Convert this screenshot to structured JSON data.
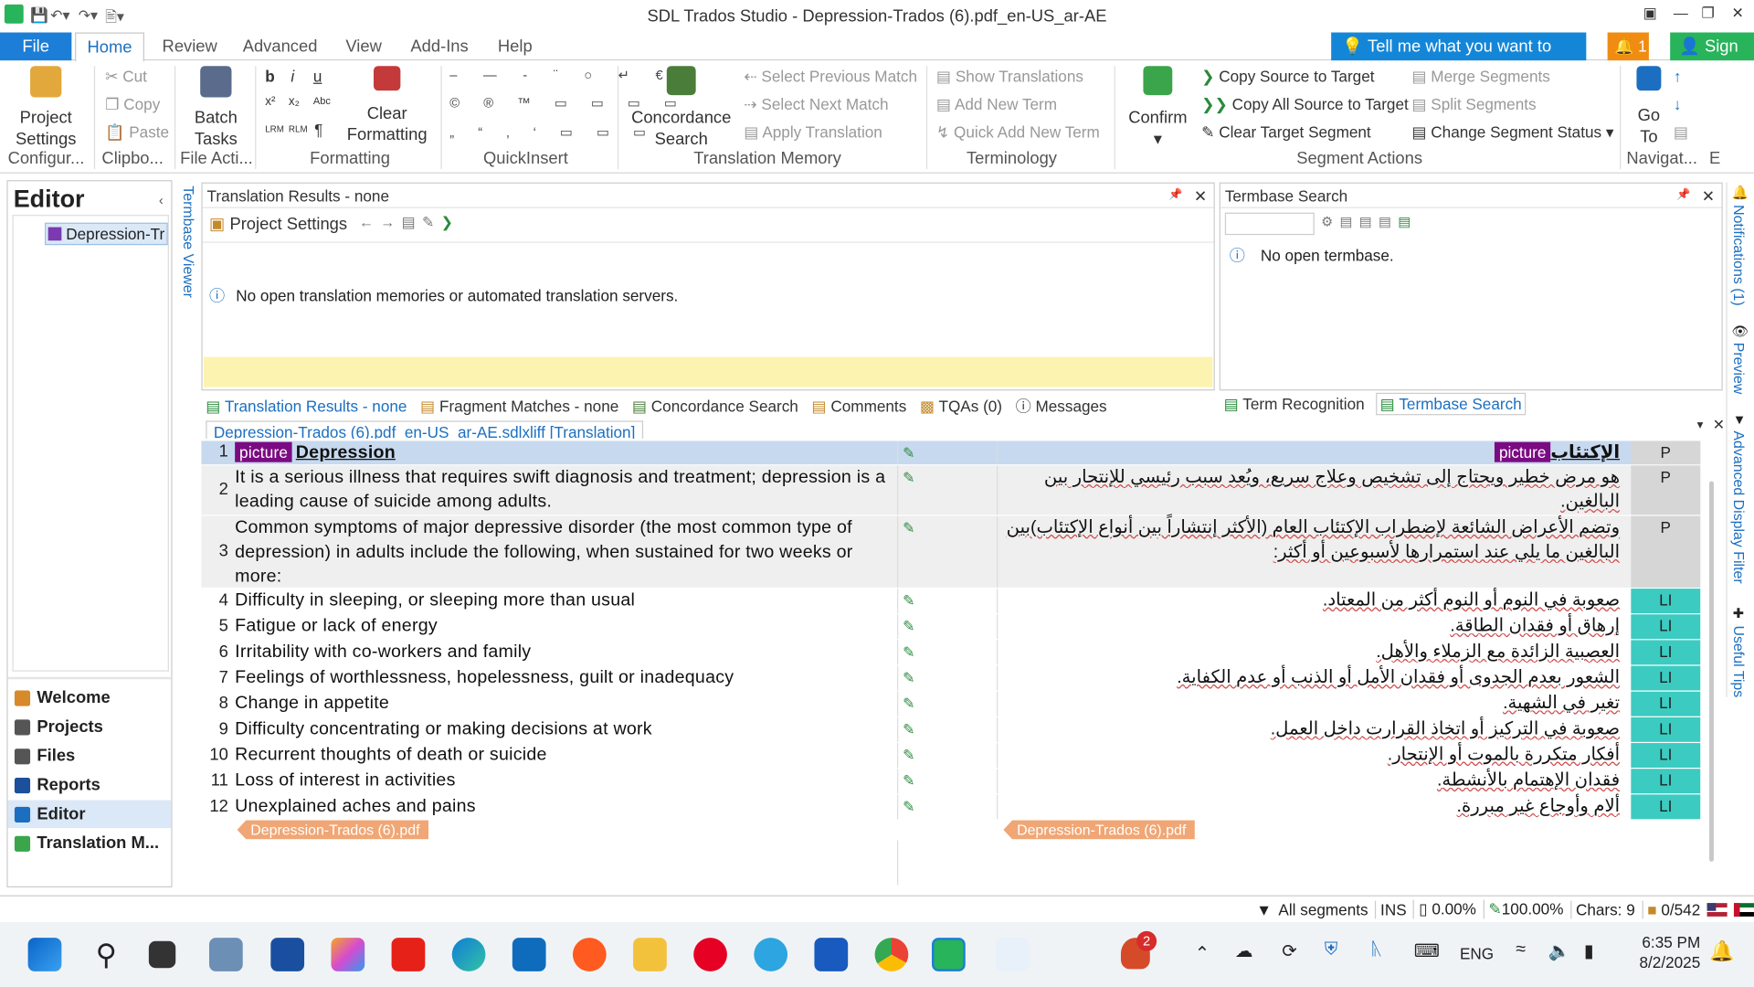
{
  "window": {
    "title": "SDL Trados Studio - Depression-Trados (6).pdf_en-US_ar-AE",
    "notifications_count": "1",
    "tell_me": "Tell me what you want to do...",
    "sign_in": "Sign In"
  },
  "menu": {
    "file": "File",
    "tabs": [
      "Home",
      "Review",
      "Advanced",
      "View",
      "Add-Ins",
      "Help"
    ]
  },
  "ribbon": {
    "project_settings": {
      "line1": "Project",
      "line2": "Settings"
    },
    "cut": "Cut",
    "copy": "Copy",
    "paste": "Paste",
    "batch_tasks": {
      "line1": "Batch",
      "line2": "Tasks"
    },
    "clear_formatting": {
      "line1": "Clear",
      "line2": "Formatting"
    },
    "concordance_search": {
      "line1": "Concordance",
      "line2": "Search"
    },
    "select_previous_match": "Select Previous Match",
    "select_next_match": "Select Next Match",
    "apply_translation": "Apply Translation",
    "show_translations": "Show Translations",
    "add_new_term": "Add New Term",
    "quick_add_new_term": "Quick Add New Term",
    "confirm": "Confirm",
    "copy_source_to_target": "Copy Source to Target",
    "copy_all_source_to_target": "Copy All Source to Target",
    "clear_target_segment": "Clear Target Segment",
    "merge_segments": "Merge Segments",
    "split_segments": "Split Segments",
    "change_segment_status": "Change Segment Status",
    "go_to": {
      "line1": "Go",
      "line2": "To"
    },
    "groups": [
      "Configur...",
      "Clipbo...",
      "File Acti...",
      "Formatting",
      "QuickInsert",
      "Translation Memory",
      "Terminology",
      "Segment Actions",
      "Navigat..."
    ],
    "e_fragment": "E"
  },
  "nav": {
    "title": "Editor",
    "tree_item": "Depression-Tr",
    "items": [
      "Welcome",
      "Projects",
      "Files",
      "Reports",
      "Editor",
      "Translation M..."
    ]
  },
  "termbase_viewer_tab": "Termbase Viewer",
  "translation_results": {
    "header": "Translation Results - none",
    "project_settings": "Project Settings",
    "message": "No open translation memories or automated translation servers."
  },
  "termbase_search": {
    "header": "Termbase Search",
    "message": "No open termbase."
  },
  "bottom_tabs_left": [
    "Translation Results - none",
    "Fragment Matches - none",
    "Concordance Search",
    "Comments",
    "TQAs (0)",
    "Messages"
  ],
  "bottom_tabs_right": [
    "Term Recognition",
    "Termbase Search"
  ],
  "document_tab": "Depression-Trados (6).pdf_en-US_ar-AE.sdlxliff [Translation]",
  "segments": [
    {
      "num": "1",
      "tag": "picture",
      "source": "Depression",
      "target": "الإكتئاب",
      "style": "P"
    },
    {
      "num": "2",
      "source": "It is a serious illness that requires swift diagnosis and treatment; depression is a leading cause of suicide among adults.",
      "target": "هو مرض خطير ويحتاج إلى تشخيص وعلاج سريع، ويُعد سبب رئيسي للإنتحار بين البالغين.",
      "style": "P"
    },
    {
      "num": "3",
      "source": "Common symptoms of major depressive disorder (the most common type of depression) in adults include the following, when sustained for two weeks or more:",
      "target": "وتضم الأعراض الشائعة لإضطراب الإكتئاب العام (الأكثر إنتشاراً بين أنواع الإكتئاب)بين البالغين  ما يلي عند استمرارها لأسبوعين أو أكثر:",
      "style": "P"
    },
    {
      "num": "4",
      "source": "Difficulty in sleeping, or sleeping more than usual",
      "target": "صعوبة في النوم أو النوم أكثر من المعتاد.",
      "style": "LI"
    },
    {
      "num": "5",
      "source": "Fatigue or lack of energy",
      "target": "إرهاق أو فقدان الطاقة.",
      "style": "LI"
    },
    {
      "num": "6",
      "source": "Irritability with co-workers and family",
      "target": "العصبية الزائدة مع الزملاء والأهل.",
      "style": "LI"
    },
    {
      "num": "7",
      "source": "Feelings of worthlessness, hopelessness, guilt or inadequacy",
      "target": "الشعور بعدم الجدوى أو فقدان الأمل أو الذنب أو عدم الكفاية.",
      "style": "LI"
    },
    {
      "num": "8",
      "source": "Change in appetite",
      "target": "تغير في الشهية.",
      "style": "LI"
    },
    {
      "num": "9",
      "source": "Difficulty concentrating or making decisions at work",
      "target": "صعوبة في التركيز أو اتخاذ القرارت داخل العمل.",
      "style": "LI"
    },
    {
      "num": "10",
      "source": "Recurrent thoughts of death or suicide",
      "target": "أفكار متكررة بالموت أو الإنتحار.",
      "style": "LI"
    },
    {
      "num": "11",
      "source": "Loss of interest in activities",
      "target": "فقدان الإهتمام بالأنشطة.",
      "style": "LI"
    },
    {
      "num": "12",
      "source": "Unexplained aches and pains",
      "target": "ألام وأوجاع غير مبررة.",
      "style": "LI"
    }
  ],
  "file_end_tag": "Depression-Trados (6).pdf",
  "right_side_tabs": [
    "Notifications (1)",
    "Preview",
    "Advanced Display Filter",
    "Useful Tips"
  ],
  "statusbar": {
    "filter": "All segments",
    "ins": "INS",
    "pct1": "0.00%",
    "pct2": "100.00%",
    "chars": "Chars: 9",
    "count": "0/542"
  },
  "taskbar": {
    "lang": "ENG",
    "time": "6:35 PM",
    "date": "8/2/2025",
    "badge": "2"
  },
  "colors": {
    "accent": "#1c7ed6",
    "tag_purple": "#7b0b82",
    "li_teal": "#3ccbc0",
    "p_gray": "#d6d6d6",
    "active_row": "#c7d9ee",
    "file_tag": "#f0a675",
    "yellow": "#fdf3b0"
  }
}
